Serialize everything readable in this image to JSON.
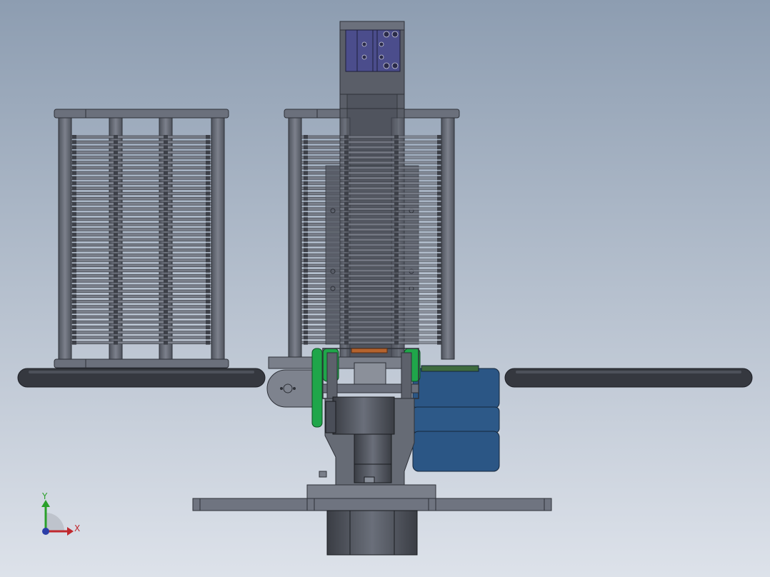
{
  "scene": {
    "background_top": "#8d9db1",
    "background_bottom": "#dde2ea",
    "metal_dark": "#4a4e58",
    "metal_mid": "#6b707c",
    "metal_light": "#8a909b",
    "accent_green": "#1fa64a",
    "accent_blue": "#2a5a8a",
    "accent_purple": "#4b4d8c",
    "accent_orange": "#b5632e"
  },
  "triad": {
    "x_label": "X",
    "y_label": "Y",
    "x_color": "#c0282e",
    "y_color": "#2aa02a",
    "z_color": "#2c3ea8"
  }
}
